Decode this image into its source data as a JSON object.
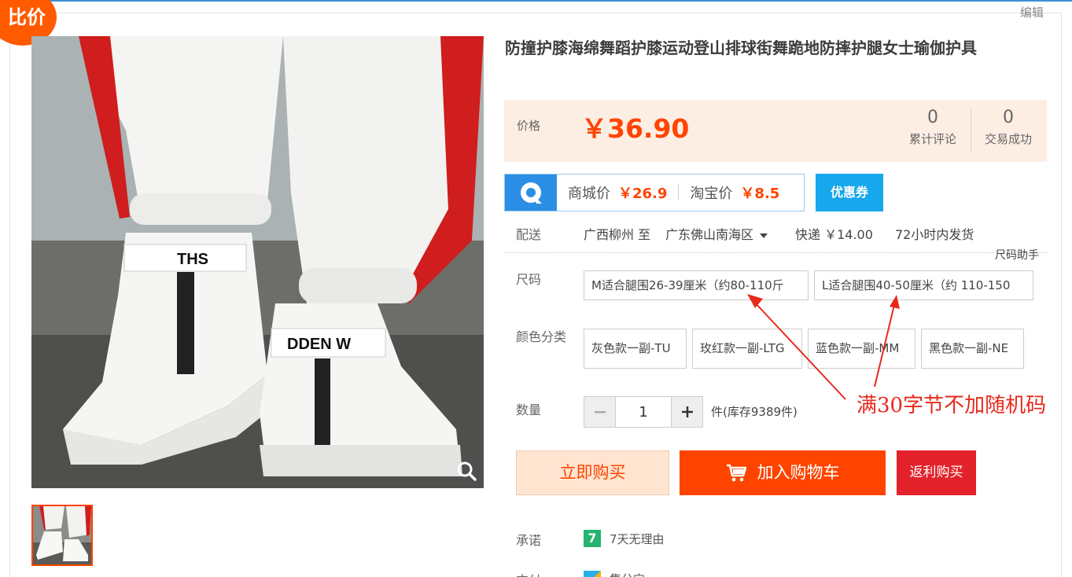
{
  "badge": {
    "compare_label": "比价"
  },
  "edit_label": "编辑",
  "product": {
    "title": "防撞护膝海绵舞蹈护膝运动登山排球街舞跪地防摔护腿女士瑜伽护具"
  },
  "price": {
    "label": "价格",
    "value": "￥36.90",
    "reviews_count": "0",
    "reviews_label": "累计评论",
    "trades_count": "0",
    "trades_label": "交易成功"
  },
  "compare": {
    "mall_label": "商城价",
    "mall_price": "￥26.9",
    "taobao_label": "淘宝价",
    "taobao_price": "￥8.5",
    "coupon_label": "优惠券"
  },
  "shipping": {
    "label": "配送",
    "from": "广西柳州 至",
    "to": "广东佛山南海区",
    "fee": "快递 ￥14.00",
    "dispatch": "72小时内发货"
  },
  "size": {
    "helper": "尺码助手",
    "label": "尺码",
    "options": [
      "M适合腿围26-39厘米（约80-110斤",
      "L适合腿围40-50厘米（约 110-150"
    ]
  },
  "color": {
    "label": "颜色分类",
    "options": [
      "灰色款一副-TU",
      "玫红款一副-LTG",
      "蓝色款一副-MM",
      "黑色款一副-NE"
    ]
  },
  "quantity": {
    "label": "数量",
    "value": "1",
    "stock": "件(库存9389件)"
  },
  "annotation": {
    "text": "满30字节不加随机码",
    "color": "#e8291c"
  },
  "actions": {
    "buy_now": "立即购买",
    "add_cart": "加入购物车",
    "rebate": "返利购买"
  },
  "promise": {
    "label": "承诺",
    "icon_text": "7",
    "text": "7天无理由"
  },
  "payment": {
    "label": "支付",
    "text": "集分宝"
  },
  "colors": {
    "accent": "#ff4400",
    "coupon": "#16a7ec",
    "rebate": "#e3222b",
    "price_bg": "#fdeee4"
  }
}
